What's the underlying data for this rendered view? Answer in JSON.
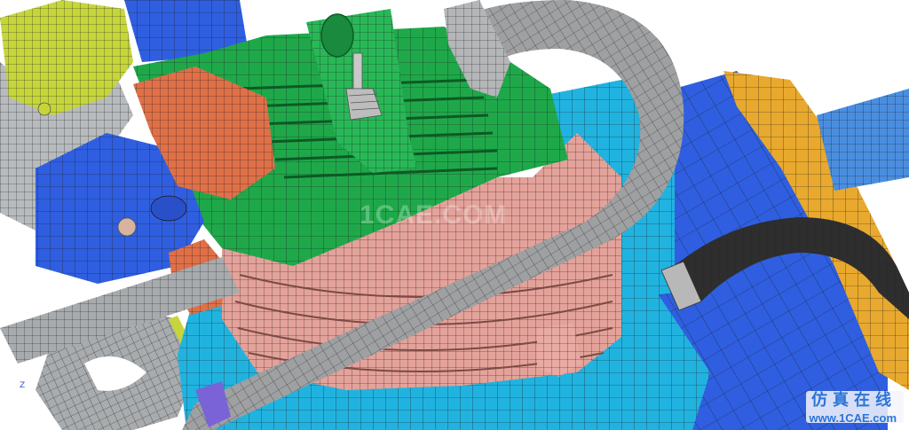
{
  "view": {
    "axis_label": "Z"
  },
  "watermark": {
    "center_text": "1CAE.COM",
    "chinese_text": "仿真在线",
    "url_text": "www.1CAE.com"
  },
  "colors": {
    "background": "#ffffff",
    "cylinder_head": "#1fa84a",
    "cylinder_block": "#e3a29a",
    "exhaust_pipe": "#9ea0a2",
    "intake_flange": "#e07048",
    "intake_body": "#2f5fe0",
    "base_light_blue": "#21b3e0",
    "base_dark_blue": "#2f5fe0",
    "gold_plate": "#e8a92e",
    "yellow_green": "#c6d63a",
    "black_hose": "#2e2e2e",
    "shaft_blue": "#4a8ee0",
    "purple_part": "#7a63d6",
    "mesh_line": "#202020"
  }
}
